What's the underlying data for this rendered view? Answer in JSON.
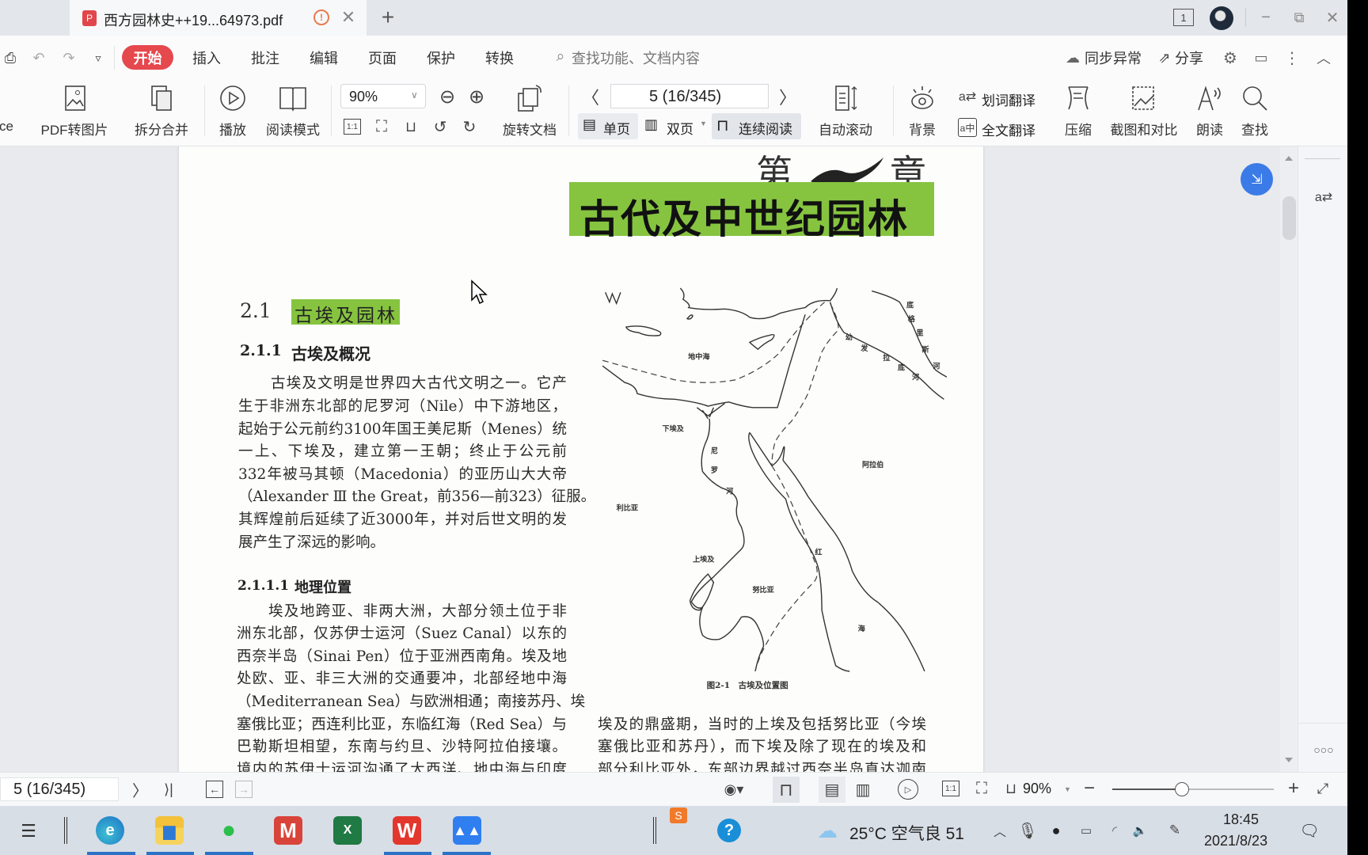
{
  "window": {
    "tab_title": "西方园林史++19...64973.pdf",
    "tab_icons": [
      "pdf-icon",
      "warning-icon",
      "close-icon"
    ],
    "new_tab_label": "+",
    "page_count_badge": "1",
    "controls": [
      "minimize-icon",
      "restore-icon",
      "close-icon"
    ]
  },
  "menu": {
    "start": "开始",
    "items": [
      "插入",
      "批注",
      "编辑",
      "页面",
      "保护",
      "转换"
    ],
    "search_placeholder": "查找功能、文档内容",
    "sync": "同步异常",
    "share": "分享"
  },
  "toolbar": {
    "cut_label": "ce",
    "pdf_to_image": "PDF转图片",
    "split_merge": "拆分合并",
    "play": "播放",
    "read_mode": "阅读模式",
    "zoom_value": "90%",
    "rotate": "旋转文档",
    "page_input": "5 (16/345)",
    "single_page": "单页",
    "double_page": "双页",
    "continuous": "连续阅读",
    "auto_scroll": "自动滚动",
    "background": "背景",
    "word_translate": "划词翻译",
    "full_translate": "全文翻译",
    "compress": "压缩",
    "screenshot_compare": "截图和对比",
    "read_aloud": "朗读",
    "find": "查找",
    "active_view": "连续阅读"
  },
  "page": {
    "chapter_prefix": "第",
    "chapter_suffix": "章",
    "chapter_number": "2",
    "chapter_title": "古代及中世纪园林",
    "section_number": "2.1",
    "section_title": "古埃及园林",
    "subsection_number": "2.1.1",
    "subsection_title": "古埃及概况",
    "para1": [
      "古埃及文明是世界四大古代文明之一。它产",
      "生于非洲东北部的尼罗河（Nile）中下游地区，",
      "起始于公元前约3100年国王美尼斯（Menes）统",
      "一上、下埃及，建立第一王朝；终止于公元前",
      "332年被马其顿（Macedonia）的亚历山大大帝",
      "（Alexander Ⅲ the Great，前356—前323）征服。",
      "其辉煌前后延续了近3000年，并对后世文明的发",
      "展产生了深远的影响。"
    ],
    "subsubsection_number": "2.1.1.1",
    "subsubsection_title": "地理位置",
    "para2": [
      "埃及地跨亚、非两大洲，大部分领土位于非",
      "洲东北部，仅苏伊士运河（Suez Canal）以东的",
      "西奈半岛（Sinai Pen）位于亚洲西南角。埃及地",
      "处欧、亚、非三大洲的交通要冲，北部经地中海",
      "（Mediterranean Sea）与欧洲相通；南接苏丹、埃",
      "塞俄比亚；西连利比亚，东临红海（Red Sea）与",
      "巴勒斯坦相望，东南与约旦、沙特阿拉伯接壤。",
      "境内的苏伊士运河沟通了大西洋、地中海与印度"
    ],
    "right_para": [
      "埃及的鼎盛期，当时的上埃及包括努比亚（今埃",
      "塞俄比亚和苏丹），而下埃及除了现在的埃及和",
      "部分利比亚外，东部边界越过西奈半岛直达迦南"
    ],
    "map": {
      "caption": "图2-1　古埃及位置图",
      "labels": {
        "mediterranean": "地中海",
        "euphrates": [
          "幼",
          "发",
          "拉",
          "底",
          "河"
        ],
        "tigris": [
          "底",
          "格",
          "里",
          "斯",
          "河"
        ],
        "lower_egypt": "下埃及",
        "nile": [
          "尼",
          "罗",
          "河"
        ],
        "arabia": "阿拉伯",
        "libya": "利比亚",
        "red_sea": [
          "红",
          "海"
        ],
        "upper_egypt": "上埃及",
        "nubia": "努比亚"
      }
    },
    "highlight_color": "#86c440"
  },
  "status": {
    "page_input": "5 (16/345)",
    "zoom": "90%",
    "zoom_slider_fraction": 0.43
  },
  "taskbar": {
    "apps": [
      "task-view",
      "edge",
      "file-explorer",
      "wechat",
      "m-app",
      "excel",
      "wps",
      "lark"
    ],
    "weather": "25°C 空气良 51",
    "time": "18:45",
    "date": "2021/8/23"
  },
  "colors": {
    "accent_red": "#e5484d",
    "highlight_green": "#86c440",
    "float_blue": "#3b7be8"
  }
}
